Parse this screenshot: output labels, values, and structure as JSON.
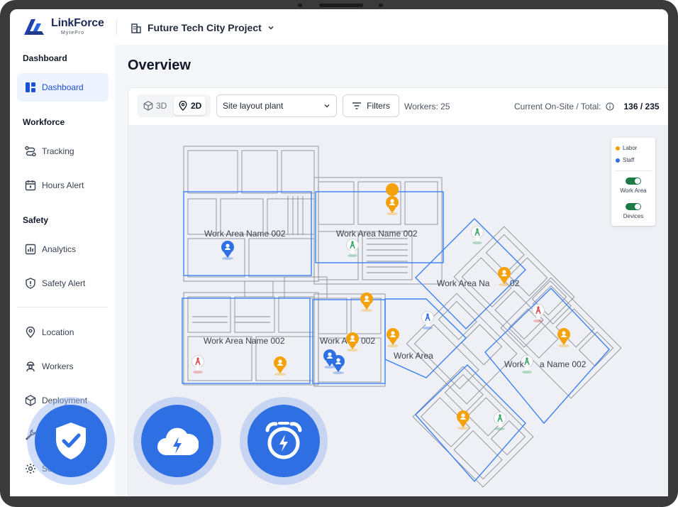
{
  "brand": {
    "name": "LinkForce",
    "sub": "MytePro"
  },
  "project": {
    "name": "Future Tech City Project"
  },
  "sidebar": {
    "sections": [
      "Dashboard",
      "Workforce",
      "Safety"
    ],
    "items": [
      {
        "label": "Dashboard",
        "icon": "dashboard-icon"
      },
      {
        "label": "Tracking",
        "icon": "route-icon"
      },
      {
        "label": "Hours Alert",
        "icon": "calendar-icon"
      },
      {
        "label": "Analytics",
        "icon": "chart-icon"
      },
      {
        "label": "Safety Alert",
        "icon": "shield-alert-icon"
      },
      {
        "label": "Location",
        "icon": "location-icon"
      },
      {
        "label": "Workers",
        "icon": "worker-icon"
      },
      {
        "label": "Deployment",
        "icon": "cube-icon"
      },
      {
        "label": "Se",
        "icon": "gear-icon"
      }
    ]
  },
  "main": {
    "title": "Overview",
    "toolbar": {
      "view_3d": "3D",
      "view_2d": "2D",
      "layout_select": "Site layout plant",
      "filters": "Filters",
      "workers": "Workers: 25",
      "onsite_label": "Current On-Site / Total:",
      "onsite_value": "136 / 235"
    },
    "map": {
      "areas": [
        "Work Area Name 002",
        "Work Area Name 002",
        "Work Area Name 002",
        "Work A",
        "002",
        "Work Area",
        "Work",
        "a Name 002",
        "Work Area Na",
        "02"
      ],
      "legend": {
        "labor": "Labor",
        "staff": "Staff",
        "work_area": "Work Area",
        "devices": "Devices"
      }
    }
  },
  "colors": {
    "accent": "#2f6fe4",
    "labor": "#f5a20a",
    "staff": "#2f6fe4",
    "device_green": "#3aa565",
    "device_red": "#d94a4a",
    "area_outline": "#3b82f6"
  }
}
